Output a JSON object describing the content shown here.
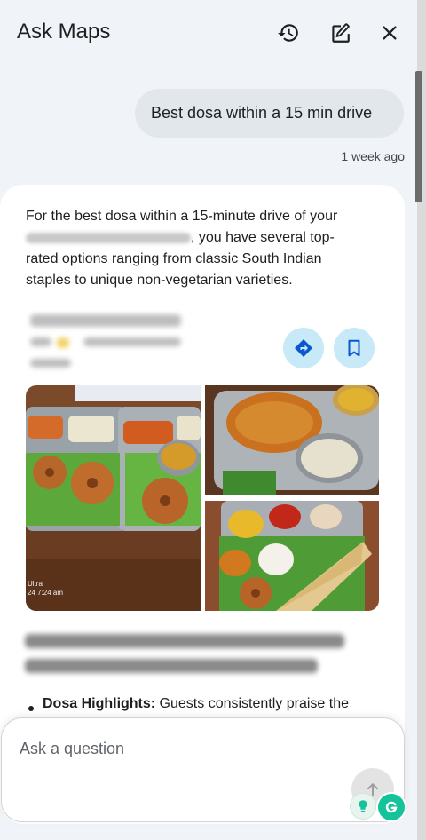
{
  "header": {
    "title": "Ask Maps",
    "history_icon": "history-icon",
    "compose_icon": "edit-icon",
    "close_icon": "close-icon"
  },
  "conversation": {
    "user_query": "Best dosa within a 15 min drive",
    "query_time": "1 week ago",
    "answer_line1": "For the best dosa within a 15-minute drive of your",
    "answer_line2_suffix": ", you have several top-",
    "answer_line3": "rated options ranging from classic South Indian",
    "answer_line4": "staples to unique non-vegetarian varieties.",
    "place": {
      "directions_icon": "directions-icon",
      "save_icon": "bookmark-icon",
      "photo_overlay_brand": "Ultra",
      "photo_overlay_time": "24 7:24 am"
    },
    "bullet_label": "Dosa Highlights:",
    "bullet_text": " Guests consistently praise the"
  },
  "composer": {
    "placeholder": "Ask a question",
    "send_icon": "send-arrow-icon"
  },
  "extensions": {
    "lightbulb_icon": "lightbulb-icon",
    "grammarly_icon": "grammarly-icon"
  },
  "colors": {
    "panel_bg": "#f0f4f9",
    "bubble_bg": "#e2e7ec",
    "action_bg": "#c7e9f8",
    "action_icon": "#0b57d0",
    "grammarly": "#15c39a"
  }
}
